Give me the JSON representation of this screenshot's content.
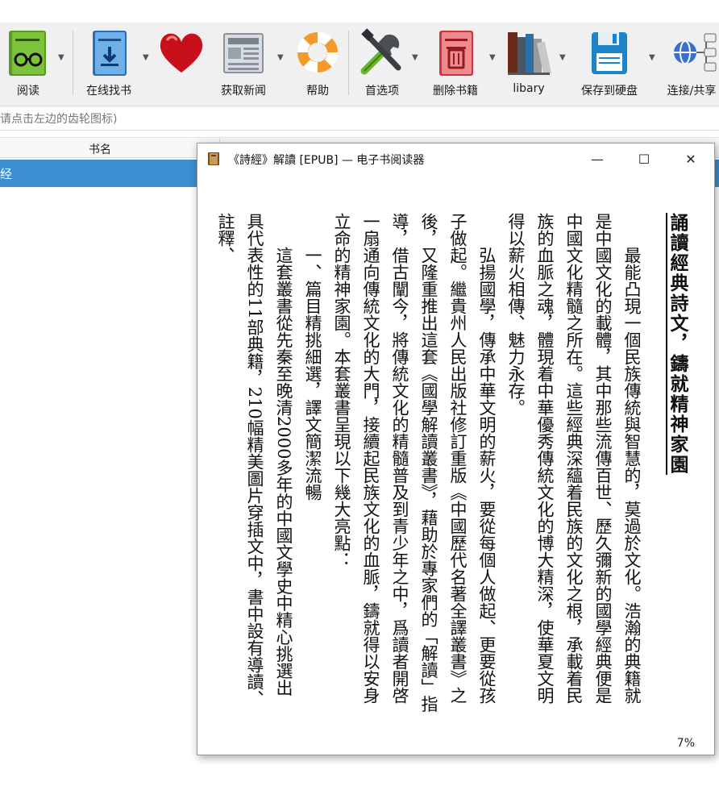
{
  "toolbar": {
    "items": [
      {
        "label": "阅读",
        "icon": "book-glasses-icon"
      },
      {
        "label": "在线找书",
        "icon": "download-book-icon"
      },
      {
        "label": "",
        "icon": "heart-icon"
      },
      {
        "label": "获取新闻",
        "icon": "newspaper-icon"
      },
      {
        "label": "帮助",
        "icon": "lifebuoy-icon"
      },
      {
        "label": "首选项",
        "icon": "tools-icon"
      },
      {
        "label": "删除书籍",
        "icon": "trash-book-icon"
      },
      {
        "label": "libary",
        "icon": "library-books-icon"
      },
      {
        "label": "保存到硬盘",
        "icon": "floppy-disk-icon"
      },
      {
        "label": "连接/共享",
        "icon": "network-globe-icon"
      }
    ]
  },
  "search": {
    "placeholder": "请点击左边的齿轮图标)"
  },
  "list": {
    "column_title": "书名",
    "selected_row": "经"
  },
  "reader": {
    "title": "《詩經》解讀 [EPUB] — 电子书阅读器",
    "minimize": "—",
    "maximize": "☐",
    "close": "✕",
    "heading": "誦讀經典詩文，鑄就精神家園",
    "paragraphs": [
      "最能凸現一個民族傳統與智慧的，莫過於文化。浩瀚的典籍就是中國文化的載體，其中那些流傳百世、歷久彌新的國學經典便是中國文化精髓之所在。這些經典深蘊着民族的文化之根，承載着民族的血脈之魂，體現着中華優秀傳統文化的博大精深，使華夏文明得以薪火相傳、魅力永存。",
      "弘揚國學，傳承中華文明的薪火，要從每個人做起、更要從孩子做起。繼貴州人民出版社修訂重版《中國歷代名著全譯叢書》之後，又隆重推出這套《國學解讀叢書》，藉助於專家們的「解讀」指導，借古闡今，將傳統文化的精髓普及到青少年之中，爲讀者開啓一扇通向傳統文化的大門，接續起民族文化的血脈，鑄就得以安身立命的精神家園。本套叢書呈現以下幾大亮點：",
      "一、篇目精挑細選，譯文簡潔流暢",
      "這套叢書從先秦至晚清2000多年的中國文學史中精心挑選出具代表性的11部典籍，210幅精美圖片穿插文中，書中設有導讀、註釋、"
    ],
    "progress": "7%"
  }
}
